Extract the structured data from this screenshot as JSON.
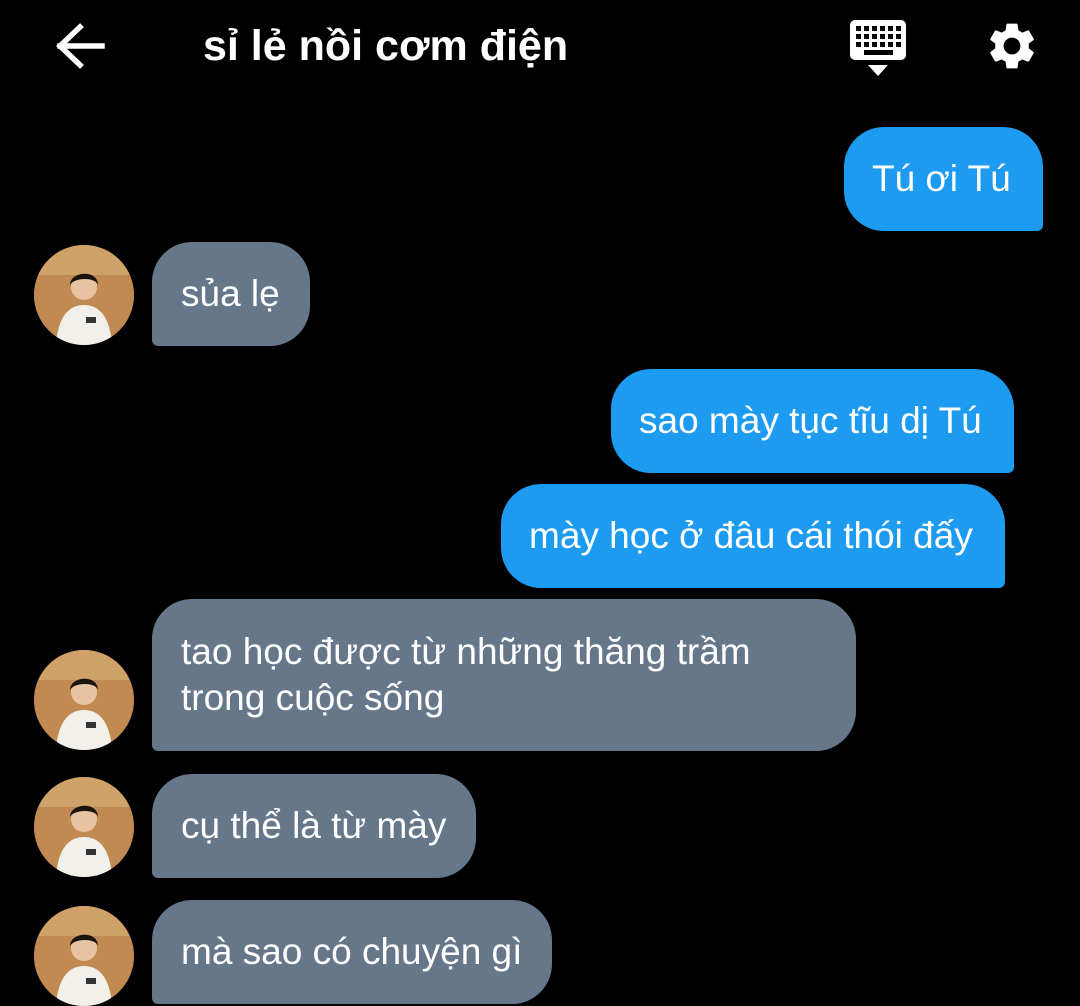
{
  "header": {
    "title": "sỉ lẻ nồi cơm điện",
    "back_icon": "arrow-left-icon",
    "keyboard_icon": "keyboard-icon",
    "settings_icon": "gear-icon"
  },
  "colors": {
    "background": "#000000",
    "outgoing_bubble": "#1d9bf0",
    "incoming_bubble": "#66778a",
    "text": "#ffffff"
  },
  "messages": [
    {
      "direction": "outgoing",
      "text": "Tú ơi Tú"
    },
    {
      "direction": "incoming",
      "text": "sủa lẹ"
    },
    {
      "direction": "outgoing",
      "text": "sao mày tục tĩu dị Tú"
    },
    {
      "direction": "outgoing",
      "text": "mày học ở đâu cái thói đấy"
    },
    {
      "direction": "incoming",
      "text": "tao học được từ những thăng trầm trong cuộc sống"
    },
    {
      "direction": "incoming",
      "text": "cụ thể là từ mày"
    },
    {
      "direction": "incoming",
      "text": "mà sao có chuyện gì"
    }
  ]
}
